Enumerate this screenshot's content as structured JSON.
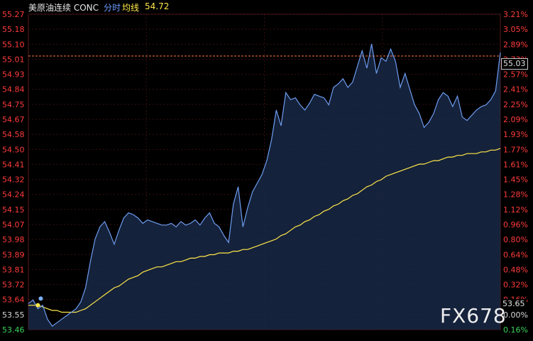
{
  "header": {
    "symbol": "美原油连续 CONC",
    "mode": "分时",
    "avg_label": "均线",
    "avg_value": "54.72"
  },
  "price_tags": {
    "last": "55.03",
    "low": "53.65"
  },
  "watermark": "FX678",
  "colors": {
    "background": "#000000",
    "price_line": "#6d9cf0",
    "area_fill": "#1a2a4a",
    "avg_line": "#ffe84a",
    "up_text": "#ff3b3b",
    "down_text": "#3cd35c",
    "grid": "#3a1010",
    "ref_line": "#ff7a3a"
  },
  "chart_data": {
    "type": "line",
    "title": "美原油连续 CONC 分时",
    "y_left_ticks": [
      "55.27",
      "55.18",
      "55.10",
      "55.01",
      "54.93",
      "54.84",
      "54.75",
      "54.67",
      "54.58",
      "54.50",
      "54.41",
      "54.32",
      "54.24",
      "54.15",
      "54.07",
      "53.98",
      "53.89",
      "53.81",
      "53.72",
      "53.64",
      "53.55",
      "53.46"
    ],
    "y_right_ticks": [
      "3.21%",
      "3.05%",
      "2.89%",
      "2.73%",
      "2.57%",
      "2.41%",
      "2.25%",
      "2.09%",
      "1.93%",
      "1.77%",
      "1.61%",
      "1.45%",
      "1.28%",
      "1.12%",
      "0.96%",
      "0.80%",
      "0.64%",
      "0.48%",
      "0.32%",
      "0.16%",
      "0.00%",
      "0.16%"
    ],
    "ylim": [
      53.46,
      55.27
    ],
    "reference_price": 53.55,
    "current_price": 55.03,
    "n_points": 100,
    "series": [
      {
        "name": "分时",
        "values": [
          53.61,
          53.63,
          53.58,
          53.6,
          53.52,
          53.48,
          53.5,
          53.52,
          53.54,
          53.56,
          53.58,
          53.62,
          53.7,
          53.85,
          53.98,
          54.05,
          54.08,
          54.02,
          53.95,
          54.03,
          54.1,
          54.13,
          54.12,
          54.1,
          54.07,
          54.09,
          54.08,
          54.07,
          54.06,
          54.06,
          54.07,
          54.05,
          54.08,
          54.06,
          54.07,
          54.09,
          54.06,
          54.1,
          54.13,
          54.07,
          54.05,
          54.0,
          53.96,
          54.18,
          54.28,
          54.05,
          54.16,
          54.25,
          54.3,
          54.35,
          54.43,
          54.55,
          54.72,
          54.63,
          54.82,
          54.78,
          54.79,
          54.75,
          54.72,
          54.76,
          54.81,
          54.8,
          54.79,
          54.75,
          54.85,
          54.87,
          54.9,
          54.85,
          54.88,
          54.97,
          55.06,
          54.96,
          55.1,
          54.93,
          55.02,
          55.0,
          55.07,
          55.0,
          54.85,
          54.93,
          54.84,
          54.75,
          54.7,
          54.62,
          54.65,
          54.7,
          54.78,
          54.82,
          54.8,
          54.74,
          54.8,
          54.68,
          54.66,
          54.69,
          54.72,
          54.74,
          54.75,
          54.78,
          54.83,
          55.05
        ]
      },
      {
        "name": "均线",
        "values": [
          53.6,
          53.6,
          53.6,
          53.59,
          53.58,
          53.57,
          53.57,
          53.56,
          53.56,
          53.56,
          53.56,
          53.57,
          53.58,
          53.6,
          53.62,
          53.64,
          53.66,
          53.68,
          53.7,
          53.71,
          53.73,
          53.75,
          53.76,
          53.77,
          53.79,
          53.8,
          53.81,
          53.82,
          53.82,
          53.83,
          53.84,
          53.85,
          53.85,
          53.86,
          53.87,
          53.87,
          53.88,
          53.88,
          53.89,
          53.89,
          53.9,
          53.9,
          53.9,
          53.91,
          53.91,
          53.92,
          53.92,
          53.93,
          53.94,
          53.95,
          53.96,
          53.97,
          53.98,
          54.0,
          54.01,
          54.03,
          54.05,
          54.06,
          54.08,
          54.09,
          54.11,
          54.12,
          54.14,
          54.15,
          54.17,
          54.18,
          54.2,
          54.21,
          54.23,
          54.24,
          54.26,
          54.28,
          54.29,
          54.31,
          54.32,
          54.34,
          54.35,
          54.36,
          54.37,
          54.38,
          54.39,
          54.4,
          54.41,
          54.41,
          54.42,
          54.43,
          54.43,
          54.44,
          54.45,
          54.45,
          54.46,
          54.46,
          54.47,
          54.47,
          54.47,
          54.48,
          54.48,
          54.49,
          54.49,
          54.5
        ]
      }
    ]
  }
}
